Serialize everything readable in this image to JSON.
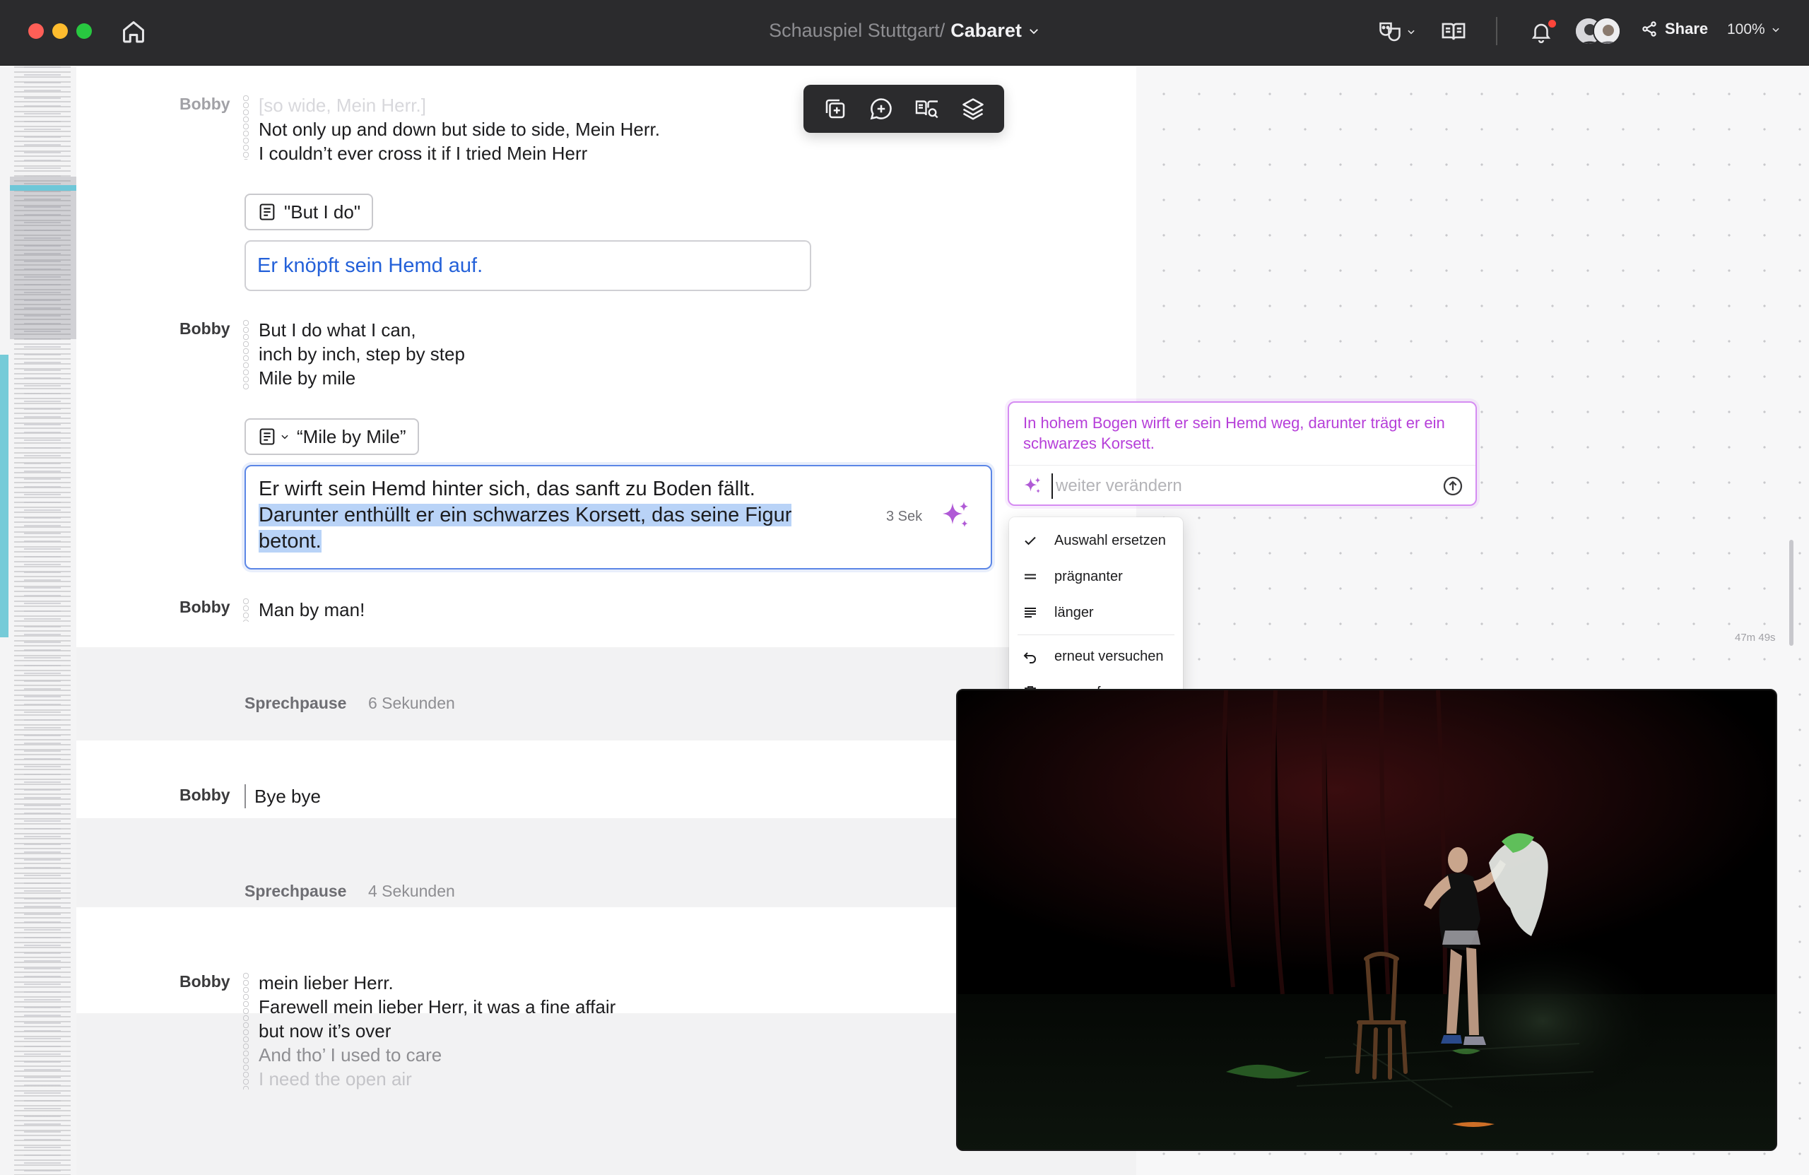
{
  "window": {
    "project": "Schauspiel Stuttgart/",
    "document": "Cabaret",
    "share_label": "Share",
    "zoom_label": "100%"
  },
  "icons": {
    "home": "home-icon",
    "theater_masks": "theater-masks-icon",
    "reading": "open-book-icon",
    "notifications": "bell-icon",
    "share": "share-icon"
  },
  "toolbar": {
    "buttons": [
      "add-copy-icon",
      "add-comment-icon",
      "dictionary-search-icon",
      "layers-icon"
    ]
  },
  "script": {
    "block1": {
      "speaker": "Bobby",
      "lines": [
        "[so wide, Mein Herr.]",
        "Not only up and down but side to side, Mein Herr.",
        "I couldn’t ever cross it if I tried Mein Herr"
      ]
    },
    "cue1": {
      "label": "\"But I do\""
    },
    "note1": {
      "text": "Er knöpft sein Hemd auf."
    },
    "block2": {
      "speaker": "Bobby",
      "lines": [
        "But I do what I can,",
        "inch by inch, step by step",
        "Mile by mile"
      ]
    },
    "cue2": {
      "label": "“Mile by Mile”"
    },
    "edit": {
      "text_plain": "Er wirft sein Hemd hinter sich, das sanft zu Boden fällt.",
      "text_selected": "Darunter enthüllt er ein schwarzes Korsett, das seine Figur betont.",
      "duration": "3 Sek"
    },
    "block3": {
      "speaker": "Bobby",
      "lines": [
        "Man by man!"
      ]
    },
    "pause1": {
      "label": "Sprechpause",
      "value": "6 Sekunden"
    },
    "block4": {
      "speaker": "Bobby",
      "lines": [
        "Bye bye"
      ]
    },
    "pause2": {
      "label": "Sprechpause",
      "value": "4 Sekunden"
    },
    "block5": {
      "speaker": "Bobby",
      "lines": [
        "mein lieber Herr.",
        "Farewell mein lieber Herr, it was a fine affair",
        "but now it’s over",
        "And tho’ I used to care",
        "I need the open air"
      ]
    },
    "time_marker": "47m 49s"
  },
  "ai": {
    "suggestion": "In hohem Bogen wirft er sein Hemd weg, darunter trägt er ein schwarzes Korsett.",
    "placeholder": "weiter verändern"
  },
  "menu": {
    "items": [
      {
        "label": "Auswahl ersetzen",
        "icon": "check-icon"
      },
      {
        "label": "prägnanter",
        "icon": "two-lines-icon"
      },
      {
        "label": "länger",
        "icon": "multi-lines-icon"
      },
      {
        "label": "erneut versuchen",
        "icon": "undo-icon"
      },
      {
        "label": "verwerfen",
        "icon": "trash-icon"
      }
    ]
  },
  "colors": {
    "accent_blue": "#2461d9",
    "ai_purple": "#b63fd9",
    "selection": "#b9d3f7"
  }
}
